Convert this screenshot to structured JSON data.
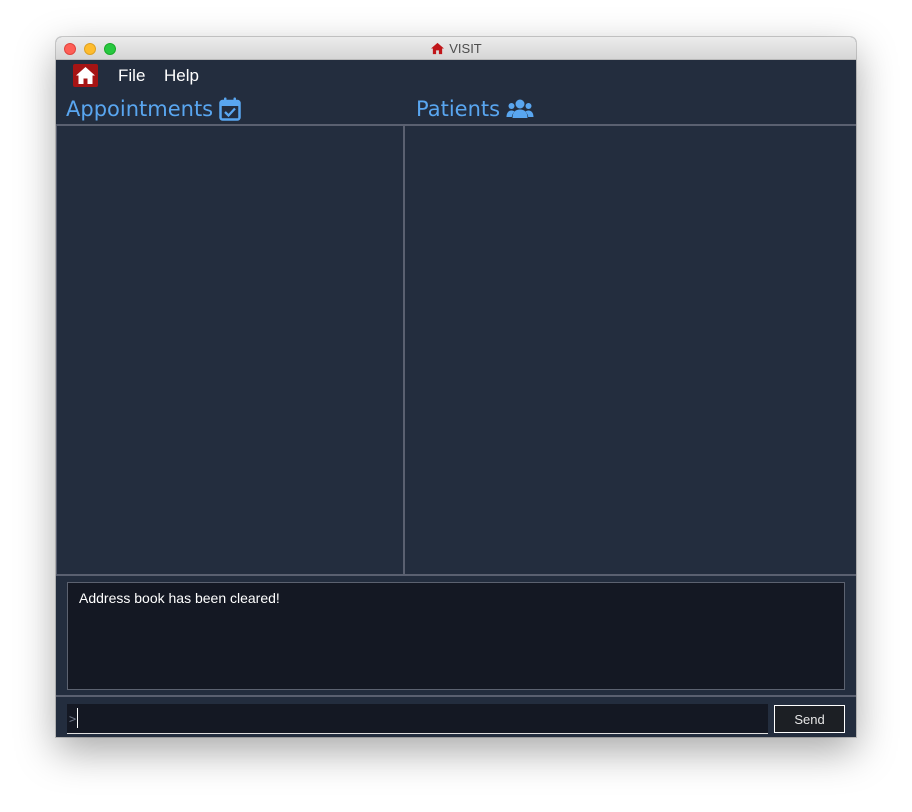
{
  "window": {
    "title": "VISIT",
    "title_icon": "home-icon"
  },
  "menubar": {
    "app_icon": "home-icon",
    "items": [
      {
        "label": "File"
      },
      {
        "label": "Help"
      }
    ]
  },
  "panels": {
    "appointments": {
      "title": "Appointments",
      "icon": "calendar-check-icon"
    },
    "patients": {
      "title": "Patients",
      "icon": "users-icon"
    }
  },
  "result": {
    "message": "Address book has been cleared!"
  },
  "command": {
    "prompt": ">",
    "value": "",
    "send_label": "Send"
  },
  "colors": {
    "background": "#232d3e",
    "accent": "#59a6f0",
    "app_icon_bg": "#a61414",
    "result_bg": "#141823"
  }
}
